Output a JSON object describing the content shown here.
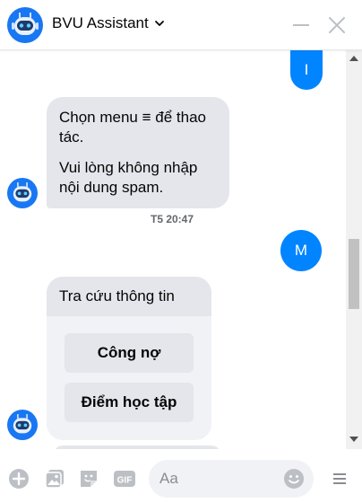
{
  "header": {
    "title": "BVU Assistant",
    "avatar_icon": "robot-icon",
    "chevron_icon": "chevron-down-icon",
    "minimize_icon": "minimize-icon",
    "close_icon": "close-icon"
  },
  "messages": {
    "out1": "I",
    "in1_line1": "Chọn menu ≡ để thao tác.",
    "in1_line2": "Vui lòng không nhập nội dung spam.",
    "timestamp": "T5 20:47",
    "out2": "M",
    "card": {
      "title": "Tra cứu thông tin",
      "buttons": [
        "Công nợ",
        "Điểm học tập"
      ]
    }
  },
  "composer": {
    "placeholder": "Aa",
    "icons": [
      "add-icon",
      "image-icon",
      "sticker-icon",
      "gif-icon",
      "emoji-icon",
      "menu-icon"
    ],
    "gif_label": "GIF"
  },
  "colors": {
    "accent": "#0084ff",
    "bubble_in": "#e4e6eb",
    "icon_gray": "#bcc0c4"
  }
}
